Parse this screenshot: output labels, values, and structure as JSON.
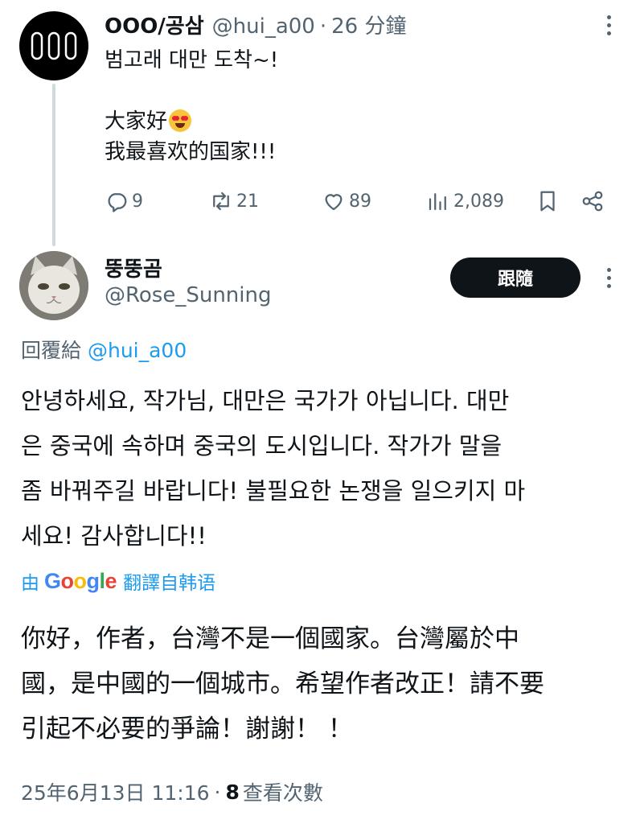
{
  "parent": {
    "name": "OOO/공삼",
    "handle": "@hui_a00",
    "separator": "·",
    "time": "26 分鐘",
    "lines": [
      "범고래 대만 도착~!",
      "",
      "大家好",
      "我最喜欢的国家!!!"
    ],
    "emoji": "smiling-face-with-heart-eyes",
    "stats": {
      "replies": "9",
      "reposts": "21",
      "likes": "89",
      "views": "2,089"
    }
  },
  "reply": {
    "name": "뚱뚱곰",
    "handle": "@Rose_Sunning",
    "follow_label": "跟隨",
    "reply_to_label": "回覆給",
    "reply_to_handle": "@hui_a00",
    "body_lines": [
      "안녕하세요, 작가님, 대만은 국가가 아닙니다. 대만",
      "은 중국에 속하며 중국의 도시입니다. 작가가 말을",
      "좀 바꿔주길 바랍니다! 불필요한 논쟁을 일으키지 마",
      "세요! 감사합니다!!"
    ],
    "translation": {
      "by_label": "由",
      "provider": "Google",
      "label": "翻譯自韩语",
      "lines": [
        "你好，作者，台灣不是一個國家。台灣屬於中",
        "國，是中國的一個城市。希望作者改正！請不要",
        "引起不必要的爭論！謝謝！ ！"
      ]
    },
    "timestamp": "25年6月13日 11:16",
    "separator": "·",
    "views_count": "8",
    "views_label": "查看次數"
  },
  "colors": {
    "text": "#0f1419",
    "secondary": "#536471",
    "accent": "#1d9bf0",
    "thread_line": "#cfd9de",
    "google_blue": "#4285f4",
    "google_red": "#ea4335",
    "google_yellow": "#fbbc05",
    "google_green": "#34a853"
  }
}
